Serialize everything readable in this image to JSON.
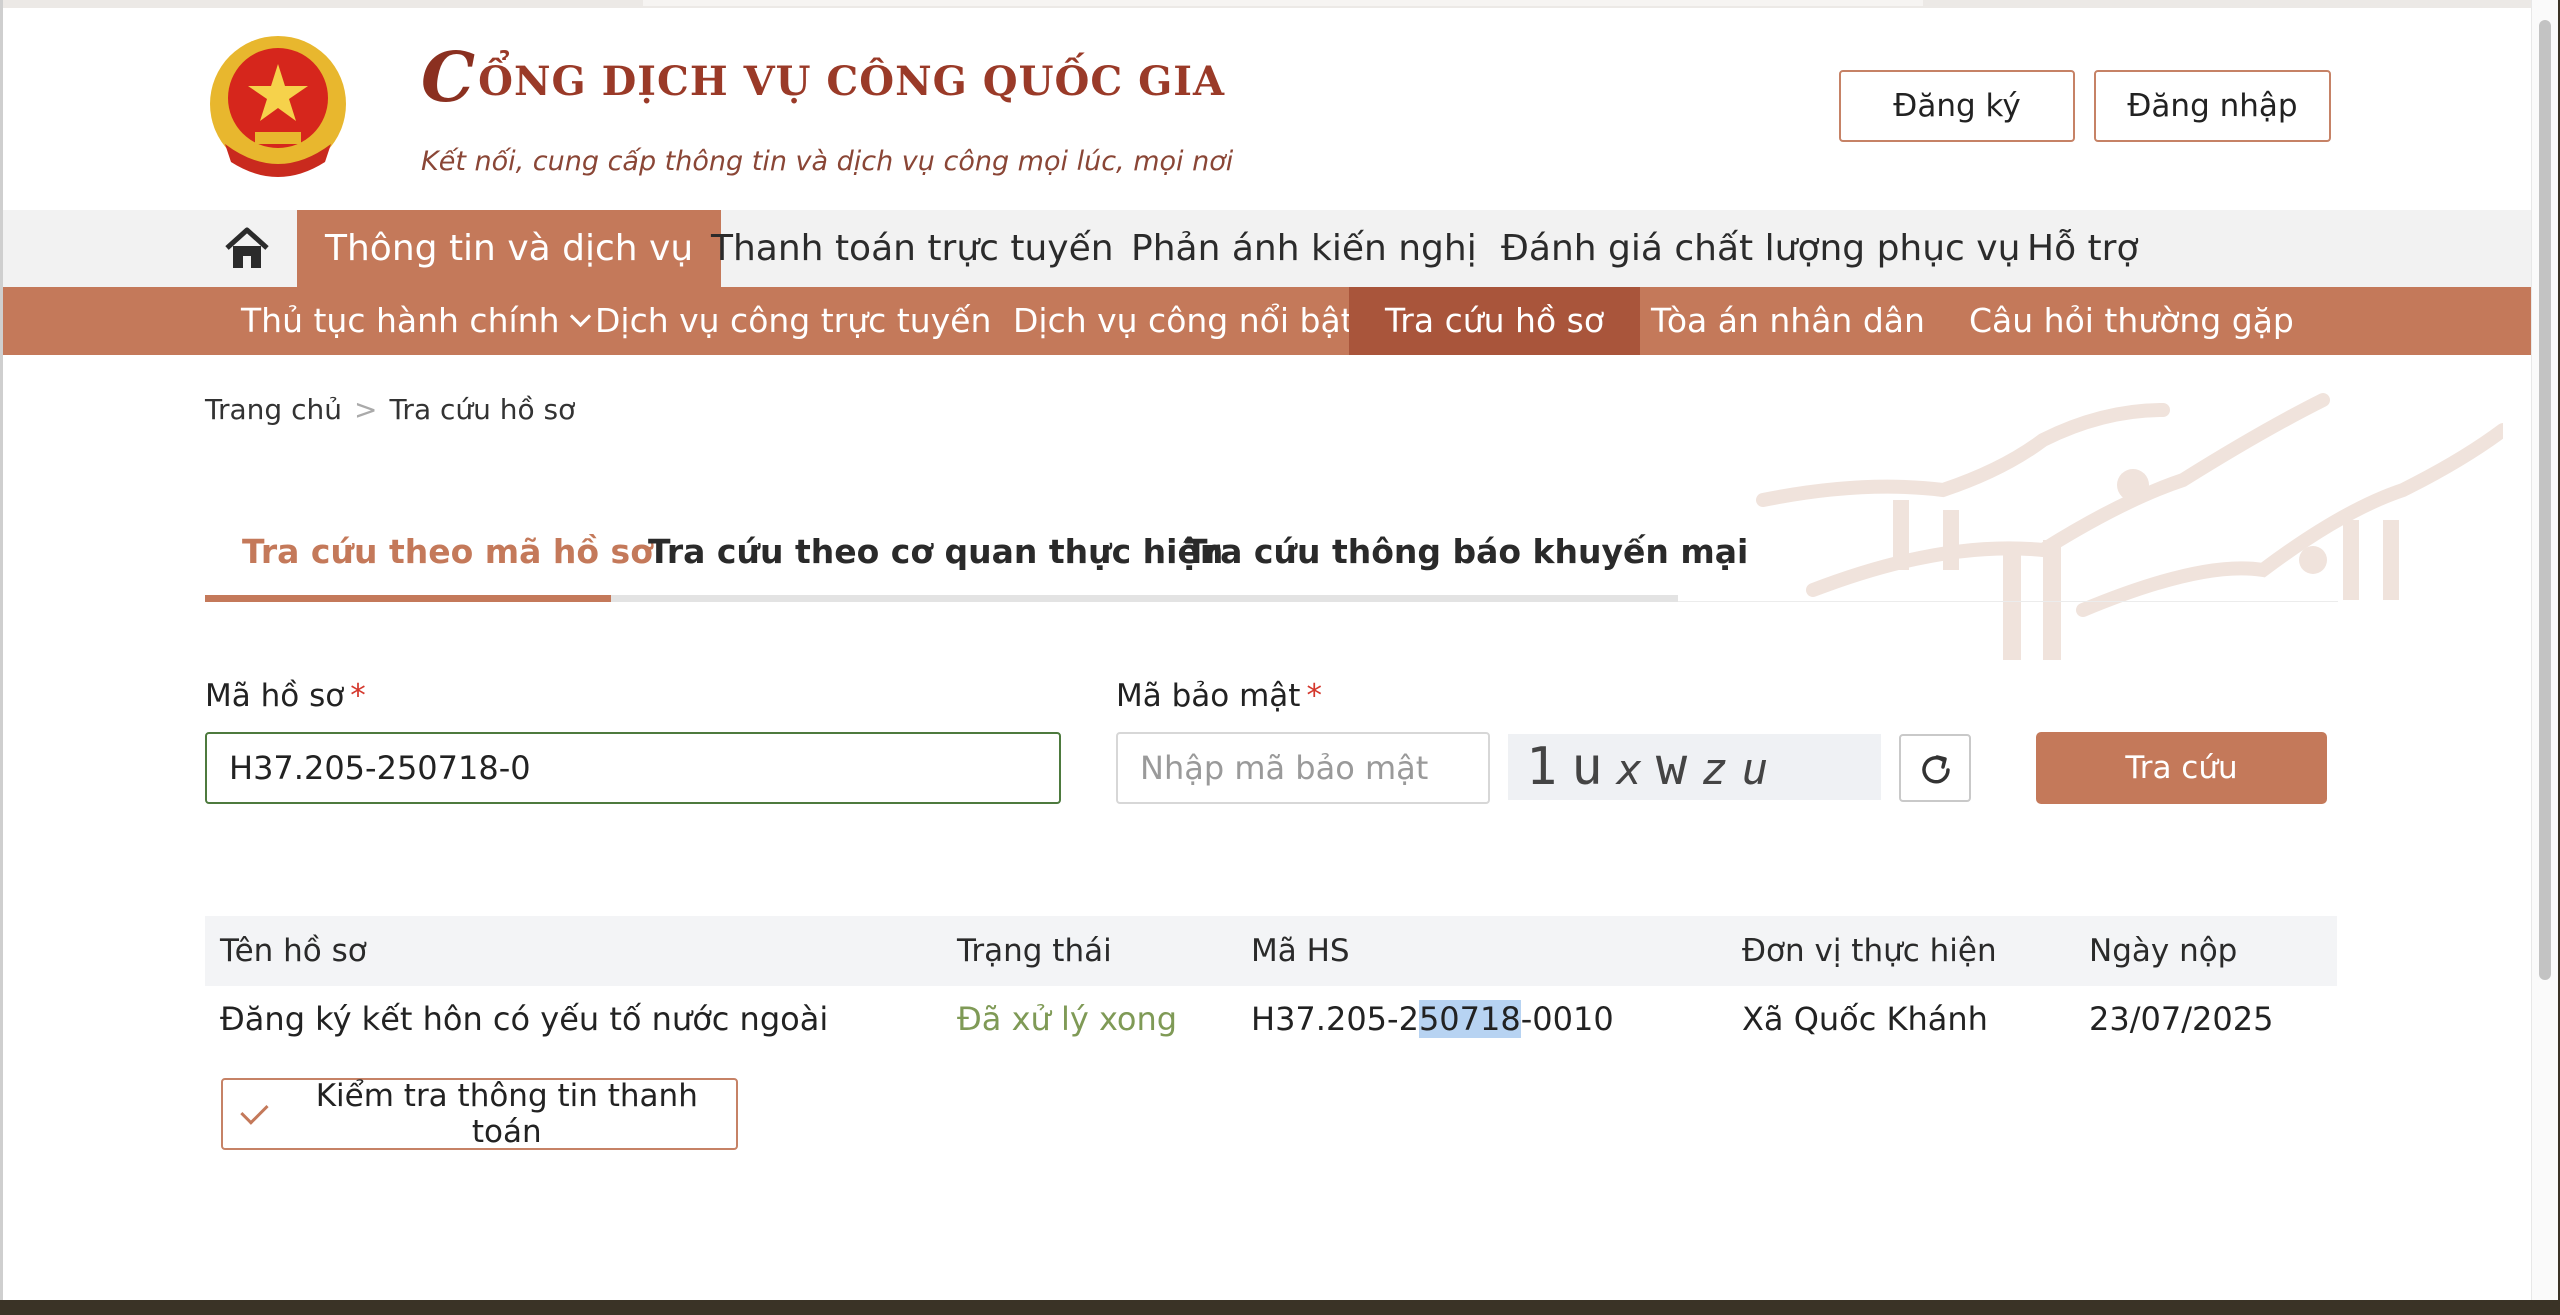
{
  "header": {
    "title_initial": "C",
    "title_rest": "ỔNG DỊCH VỤ CÔNG QUỐC GIA",
    "subtitle": "Kết nối, cung cấp thông tin và dịch vụ công mọi lúc, mọi nơi",
    "register_label": "Đăng ký",
    "login_label": "Đăng nhập"
  },
  "main_nav": {
    "items": [
      {
        "label": "Thông tin và dịch vụ",
        "active": true
      },
      {
        "label": "Thanh toán trực tuyến"
      },
      {
        "label": "Phản ánh kiến nghị"
      },
      {
        "label": "Đánh giá chất lượng phục vụ"
      },
      {
        "label": "Hỗ trợ"
      }
    ]
  },
  "sub_nav": {
    "items": [
      {
        "label": "Thủ tục hành chính"
      },
      {
        "label": "Dịch vụ công trực tuyến"
      },
      {
        "label": "Dịch vụ công nổi bật"
      },
      {
        "label": "Tra cứu hồ sơ",
        "active": true
      },
      {
        "label": "Tòa án nhân dân"
      },
      {
        "label": "Câu hỏi thường gặp"
      }
    ]
  },
  "breadcrumb": {
    "home": "Trang chủ",
    "separator": ">",
    "current": "Tra cứu hồ sơ"
  },
  "tabs": [
    {
      "label": "Tra cứu theo mã hồ sơ",
      "active": true
    },
    {
      "label": "Tra cứu theo cơ quan thực hiện"
    },
    {
      "label": "Tra cứu thông báo khuyến mại"
    }
  ],
  "form": {
    "code_label": "Mã hồ sơ",
    "required_mark": "*",
    "code_value": "H37.205-250718-0",
    "security_label": "Mã bảo mật",
    "security_placeholder": "Nhập mã bảo mật",
    "captcha_chars": [
      "1",
      "u",
      "x",
      "w",
      "z",
      "u"
    ],
    "search_label": "Tra cứu"
  },
  "table": {
    "headers": [
      "Tên hồ sơ",
      "Trạng thái",
      "Mã HS",
      "Đơn vị thực hiện",
      "Ngày nộp"
    ],
    "rows": [
      {
        "name": "Đăng ký kết hôn có yếu tố nước ngoài",
        "status": "Đã xử lý xong",
        "code_pre": "H37.205-2",
        "code_sel": "50718",
        "code_post": "-0010",
        "unit": "Xã Quốc Khánh",
        "date": "23/07/2025"
      }
    ],
    "payment_check_label": "Kiểm tra thông tin thanh toán"
  },
  "colors": {
    "accent": "#c4795a",
    "accent_dark": "#a9553b",
    "brand_red": "#9a3a28",
    "status_green": "#7f9a56"
  }
}
